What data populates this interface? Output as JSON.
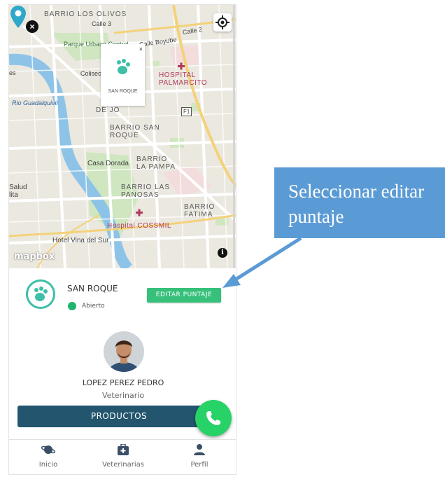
{
  "map": {
    "labels": {
      "barrio_los_olivos": "BARRIO LOS\nOLIVOS",
      "calle3": "Calle 3",
      "calle_boyube": "Calle Boyube",
      "calle2": "Calle 2",
      "parque": "Parque Urbano Central",
      "coliseo": "Coliseo",
      "hospital_palmarcito": "HOSPITAL\nPALMARCITO",
      "rio": "Rio Guadalquivir",
      "de_jo": "DE JO",
      "f1": "F1",
      "barrio_san_roque": "BARRIO SAN\nROQUE",
      "casa_dorada": "Casa Dorada",
      "barrio_la_pampa": "BARRIO\nLA PAMPA",
      "barrio_las_panosas": "BARRIO LAS\nPANOSAS",
      "barrio_fatima": "BARRIO\nFATIMA",
      "salud": "Salud\nlita",
      "hospital_cossmil": "Hospital COSSMIL",
      "hotel": "Hotel Vina del Sur",
      "es": "es"
    },
    "popup": {
      "name": "SAN ROQUE",
      "close": "×"
    },
    "close_glyph": "×",
    "info_glyph": "i",
    "attribution": "mapbox"
  },
  "clinic": {
    "name": "SAN ROQUE",
    "status": "Abierto",
    "edit_button": "EDITAR PUNTAJE"
  },
  "vet": {
    "name": "LOPEZ PEREZ PEDRO",
    "role": "Veterinario"
  },
  "products_button": "PRODUCTOS",
  "nav": [
    {
      "label": "Inicio",
      "icon": "planet-icon"
    },
    {
      "label": "Veterinarias",
      "icon": "medical-kit-icon"
    },
    {
      "label": "Perfil",
      "icon": "person-icon"
    }
  ],
  "callout": {
    "text": "Seleccionar editar puntaje"
  },
  "colors": {
    "accent_green": "#36c07a",
    "primary_dark": "#23566e",
    "fab_green": "#27d267",
    "callout_blue": "#5b9bd5",
    "logo_teal": "#3dbfa8"
  }
}
